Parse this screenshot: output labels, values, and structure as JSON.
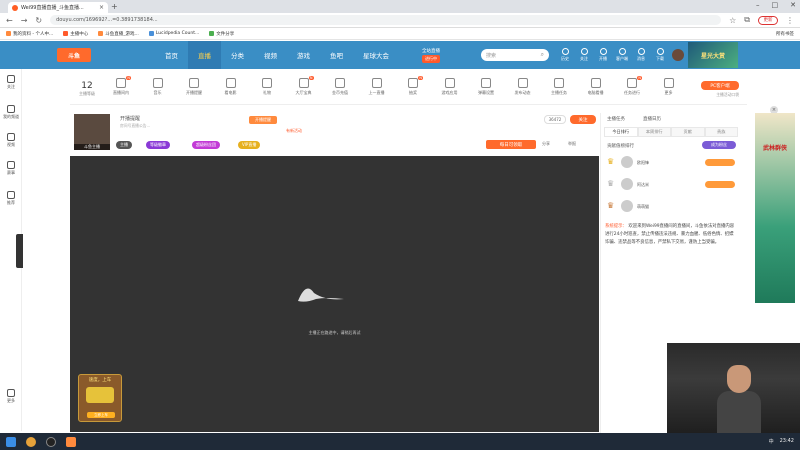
{
  "browser": {
    "tab_title": "Wei99直播直播_斗鱼直播...",
    "url": "douyu.com/169692?...=0.3891738184..."
  },
  "bookmarks": [
    {
      "label": "我的资料 - 个人中...",
      "color": "#ff8a3d"
    },
    {
      "label": "主播中心",
      "color": "#ff5a2c"
    },
    {
      "label": "斗鱼直播_游戏...",
      "color": "#ff8a3d"
    },
    {
      "label": "Lucidpedia Count...",
      "color": "#4a90d9"
    },
    {
      "label": "文件分享",
      "color": "#4caf50"
    }
  ],
  "bookmarks_right": "所有书签",
  "header": {
    "logo": "斗鱼",
    "nav": [
      "首页",
      "直播",
      "分类",
      "视频",
      "游戏",
      "鱼吧",
      "星球大会"
    ],
    "active_nav": "直播",
    "promo_title": "全站直播",
    "promo_btn": "进行中",
    "search_placeholder": "搜索",
    "icons": [
      "历史",
      "关注",
      "开播",
      "客户端",
      "消息",
      "下载"
    ],
    "banner": "星光大赏"
  },
  "leftrail": [
    "关注",
    "我的频道",
    "视频",
    "赛事",
    "推荐",
    "更多"
  ],
  "toolbar": {
    "level_num": "12",
    "level_label": "主播等级",
    "tools": [
      "直播间内",
      "音乐",
      "开播提醒",
      "看电影",
      "礼物",
      "大厅宝典",
      "金币充值",
      "上一直播",
      "抽奖",
      "游戏应用",
      "弹幕设置",
      "发布动态",
      "主播任务",
      "电脑看播",
      "任务进行",
      "更多"
    ],
    "pc_btn": "PC客户端",
    "pc_note": "主播活动口袋"
  },
  "streamer": {
    "avatar_caption": "斗鱼主播",
    "title": "开播提醒",
    "subtitle": "房间号直播公告...",
    "sub_btn": "开播提醒",
    "sub_note": "有新活动",
    "tags": [
      {
        "label": "主播",
        "color": "#555"
      },
      {
        "label": "等级徽章",
        "color": "#8a3ad6"
      },
      {
        "label": "超级粉丝团",
        "color": "#c23ad6"
      },
      {
        "label": "VIP直播",
        "color": "#e6b020"
      }
    ],
    "follow_count": "36472",
    "follow_btn": "关注",
    "task_btn": "每日可领取",
    "share": "分享",
    "report": "举报"
  },
  "player": {
    "loading_text": "主播正在路途中，请稍后再试",
    "promo_title": "速度，上车",
    "promo_btn": "立即上车"
  },
  "rightpanel": {
    "top_links": [
      "主播任务",
      "直播日历"
    ],
    "tabs": [
      "今日排行",
      "本周排行",
      "贡献",
      "贵族"
    ],
    "active_tab": "今日排行",
    "sub_label": "贡献值榜排行",
    "sub_btn": "成为粉丝",
    "ranks": [
      {
        "name": "欧阳锋",
        "crown": "♛",
        "crown_color": "#e6b020"
      },
      {
        "name": "阿达米",
        "crown": "♛",
        "crown_color": "#aaaaaa"
      },
      {
        "name": "萌萌猫",
        "crown": "♛",
        "crown_color": "#c87a3a"
      }
    ],
    "sys_label": "系统提示：",
    "sys_msg": "欢迎来到Wei99直播间的直播间，斗鱼依法对直播内容进行24小时巡查，禁止传播违法违规、暴力血腥、低俗色情、招嫖诈骗、违禁品等不良信息，严禁私下交易，谨防上当受骗。"
  },
  "farright_ad": {
    "title": "武林群侠",
    "close": "×"
  },
  "taskbar": {
    "tray": [
      "中",
      "23:42"
    ]
  }
}
